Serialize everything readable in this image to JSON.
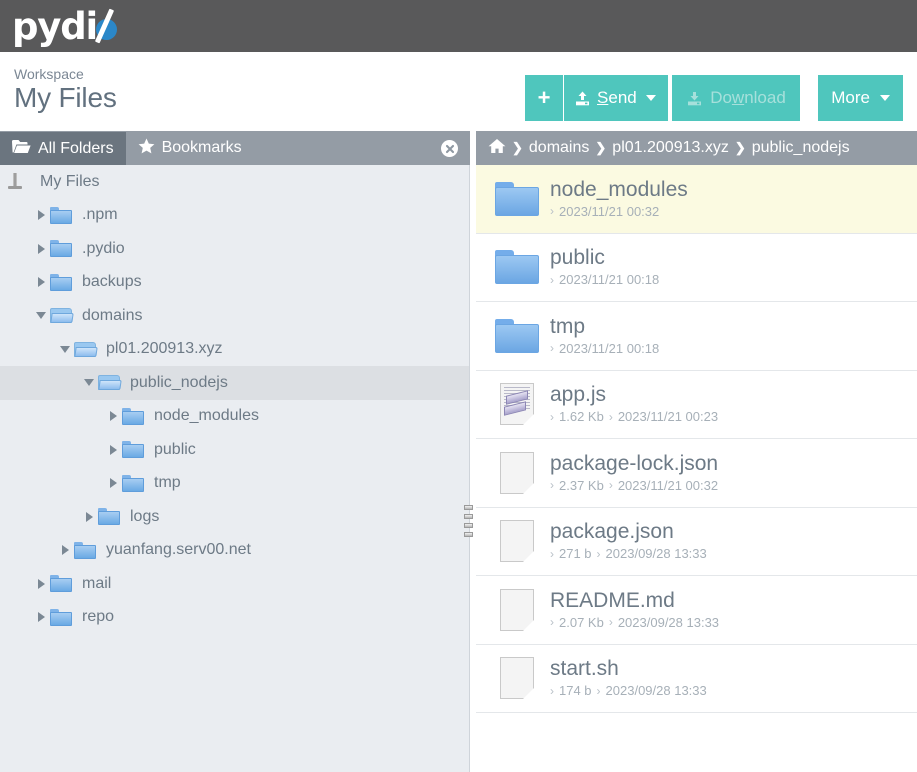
{
  "app": {
    "logo_text": "pydi",
    "logo_icon": "pydio-planet-logo"
  },
  "workspace": {
    "label": "Workspace",
    "title": "My Files"
  },
  "toolbar": {
    "new_label": "+",
    "new_icon": "plus-icon",
    "send_label": "Send",
    "send_icon": "upload-icon",
    "download_label": "Download",
    "download_icon": "download-icon",
    "download_disabled": true,
    "more_label": "More",
    "accent_color": "#4fc6bd",
    "disabled_text_color": "#a6e0db"
  },
  "tabs": {
    "items": [
      {
        "label": "All Folders",
        "icon": "open-folder-icon",
        "active": true
      },
      {
        "label": "Bookmarks",
        "icon": "star-icon",
        "active": false
      }
    ],
    "close_icon": "close-circle-icon"
  },
  "breadcrumb": {
    "home_icon": "home-icon",
    "separator": "❯",
    "items": [
      "domains",
      "pl01.200913.xyz",
      "public_nodejs"
    ]
  },
  "tree": {
    "root": {
      "label": "My Files",
      "icon": "drive-icon",
      "depth": 0
    },
    "nodes": [
      {
        "label": ".npm",
        "depth": 1,
        "state": "collapsed",
        "icon": "folder-closed-icon",
        "selected": false
      },
      {
        "label": ".pydio",
        "depth": 1,
        "state": "collapsed",
        "icon": "folder-closed-icon",
        "selected": false
      },
      {
        "label": "backups",
        "depth": 1,
        "state": "collapsed",
        "icon": "folder-closed-icon",
        "selected": false
      },
      {
        "label": "domains",
        "depth": 1,
        "state": "expanded",
        "icon": "folder-open-icon",
        "selected": false
      },
      {
        "label": "pl01.200913.xyz",
        "depth": 2,
        "state": "expanded",
        "icon": "folder-open-icon",
        "selected": false
      },
      {
        "label": "public_nodejs",
        "depth": 3,
        "state": "expanded",
        "icon": "folder-open-icon",
        "selected": true
      },
      {
        "label": "node_modules",
        "depth": 4,
        "state": "collapsed",
        "icon": "folder-closed-icon",
        "selected": false
      },
      {
        "label": "public",
        "depth": 4,
        "state": "collapsed",
        "icon": "folder-closed-icon",
        "selected": false
      },
      {
        "label": "tmp",
        "depth": 4,
        "state": "collapsed",
        "icon": "folder-closed-icon",
        "selected": false
      },
      {
        "label": "logs",
        "depth": 3,
        "state": "collapsed",
        "icon": "folder-closed-icon",
        "selected": false
      },
      {
        "label": "yuanfang.serv00.net",
        "depth": 2,
        "state": "collapsed",
        "icon": "folder-closed-icon",
        "selected": false
      },
      {
        "label": "mail",
        "depth": 1,
        "state": "collapsed",
        "icon": "folder-closed-icon",
        "selected": false
      },
      {
        "label": "repo",
        "depth": 1,
        "state": "collapsed",
        "icon": "folder-closed-icon",
        "selected": false
      }
    ]
  },
  "files": {
    "rows": [
      {
        "name": "node_modules",
        "type": "folder",
        "icon": "folder-icon",
        "size": "",
        "modified": "2023/11/21 00:32",
        "hover": true
      },
      {
        "name": "public",
        "type": "folder",
        "icon": "folder-icon",
        "size": "",
        "modified": "2023/11/21 00:18",
        "hover": false
      },
      {
        "name": "tmp",
        "type": "folder",
        "icon": "folder-icon",
        "size": "",
        "modified": "2023/11/21 00:18",
        "hover": false
      },
      {
        "name": "app.js",
        "type": "file",
        "icon": "js-file-icon",
        "size": "1.62 Kb",
        "modified": "2023/11/21 00:23",
        "hover": false
      },
      {
        "name": "package-lock.json",
        "type": "file",
        "icon": "document-icon",
        "size": "2.37 Kb",
        "modified": "2023/11/21 00:32",
        "hover": false
      },
      {
        "name": "package.json",
        "type": "file",
        "icon": "document-icon",
        "size": "271 b",
        "modified": "2023/09/28 13:33",
        "hover": false
      },
      {
        "name": "README.md",
        "type": "file",
        "icon": "document-icon",
        "size": "2.07 Kb",
        "modified": "2023/09/28 13:33",
        "hover": false
      },
      {
        "name": "start.sh",
        "type": "file",
        "icon": "document-icon",
        "size": "174 b",
        "modified": "2023/09/28 13:33",
        "hover": false
      }
    ],
    "meta_separator": "›",
    "hover_color": "#fbfae1"
  },
  "splitter": {
    "icon": "drag-handle-icon"
  }
}
